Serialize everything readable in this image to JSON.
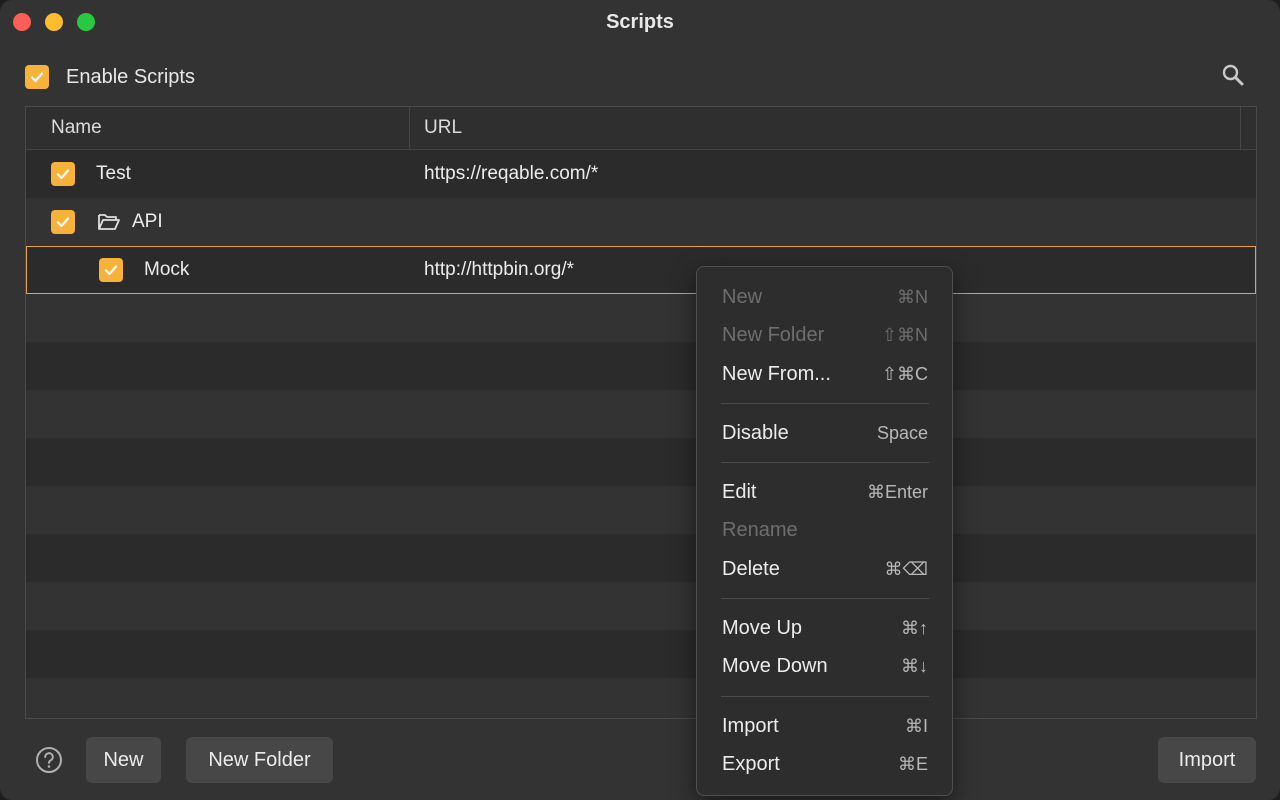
{
  "window": {
    "title": "Scripts"
  },
  "enable": {
    "label": "Enable Scripts",
    "checked": true
  },
  "table": {
    "columns": [
      "Name",
      "URL"
    ],
    "rows": [
      {
        "name": "Test",
        "url": "https://reqable.com/*",
        "checked": true,
        "type": "script"
      },
      {
        "name": "API",
        "url": "",
        "checked": true,
        "type": "folder"
      },
      {
        "name": "Mock",
        "url": "http://httpbin.org/*",
        "checked": true,
        "type": "script",
        "selected": true
      }
    ]
  },
  "buttons": {
    "new": "New",
    "new_folder": "New Folder",
    "import": "Import"
  },
  "context_menu": {
    "items": [
      {
        "label": "New",
        "shortcut": "⌘N",
        "enabled": false
      },
      {
        "label": "New Folder",
        "shortcut": "⇧⌘N",
        "enabled": false
      },
      {
        "label": "New From...",
        "shortcut": "⇧⌘C",
        "enabled": true
      },
      {
        "label": "Disable",
        "shortcut": "Space",
        "enabled": true
      },
      {
        "label": "Edit",
        "shortcut": "⌘Enter",
        "enabled": true
      },
      {
        "label": "Rename",
        "shortcut": "",
        "enabled": false
      },
      {
        "label": "Delete",
        "shortcut": "⌘⌫",
        "enabled": true
      },
      {
        "label": "Move Up",
        "shortcut": "⌘↑",
        "enabled": true
      },
      {
        "label": "Move Down",
        "shortcut": "⌘↓",
        "enabled": true
      },
      {
        "label": "Import",
        "shortcut": "⌘I",
        "enabled": true
      },
      {
        "label": "Export",
        "shortcut": "⌘E",
        "enabled": true
      }
    ]
  },
  "colors": {
    "accent": "#f6b23b",
    "selection_border": "#e8a33a",
    "background": "#333333"
  }
}
